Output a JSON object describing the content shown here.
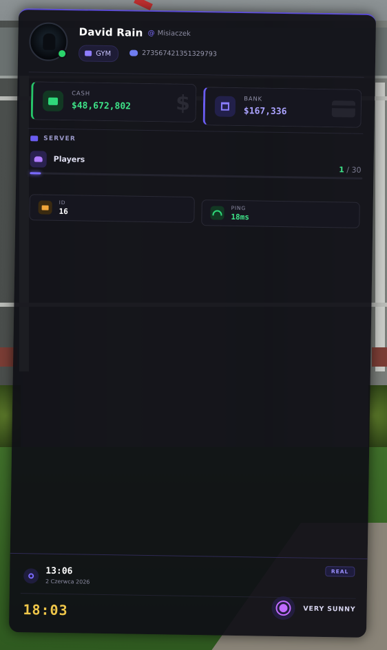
{
  "player": {
    "name": "David Rain",
    "handle": "Misiaczek",
    "job": "GYM",
    "discord_id": "273567421351329793"
  },
  "money": {
    "cash_label": "CASH",
    "cash_value": "$48,672,802",
    "bank_label": "BANK",
    "bank_value": "$167,336"
  },
  "server": {
    "section_label": "SERVER",
    "players_label": "Players",
    "players_online": "1",
    "players_max": "/ 30",
    "players_fraction": 0.033
  },
  "stats": {
    "id_label": "ID",
    "id_value": "16",
    "ping_label": "PING",
    "ping_value": "18ms"
  },
  "clock": {
    "real_time": "13:06",
    "real_date": "2 Czerwca 2026",
    "real_badge": "REAL",
    "game_time": "18:03"
  },
  "weather": {
    "label": "VERY SUNNY"
  },
  "colors": {
    "accent": "#7b6bff",
    "cash_green": "#3ee388",
    "gold": "#f0c74a"
  }
}
